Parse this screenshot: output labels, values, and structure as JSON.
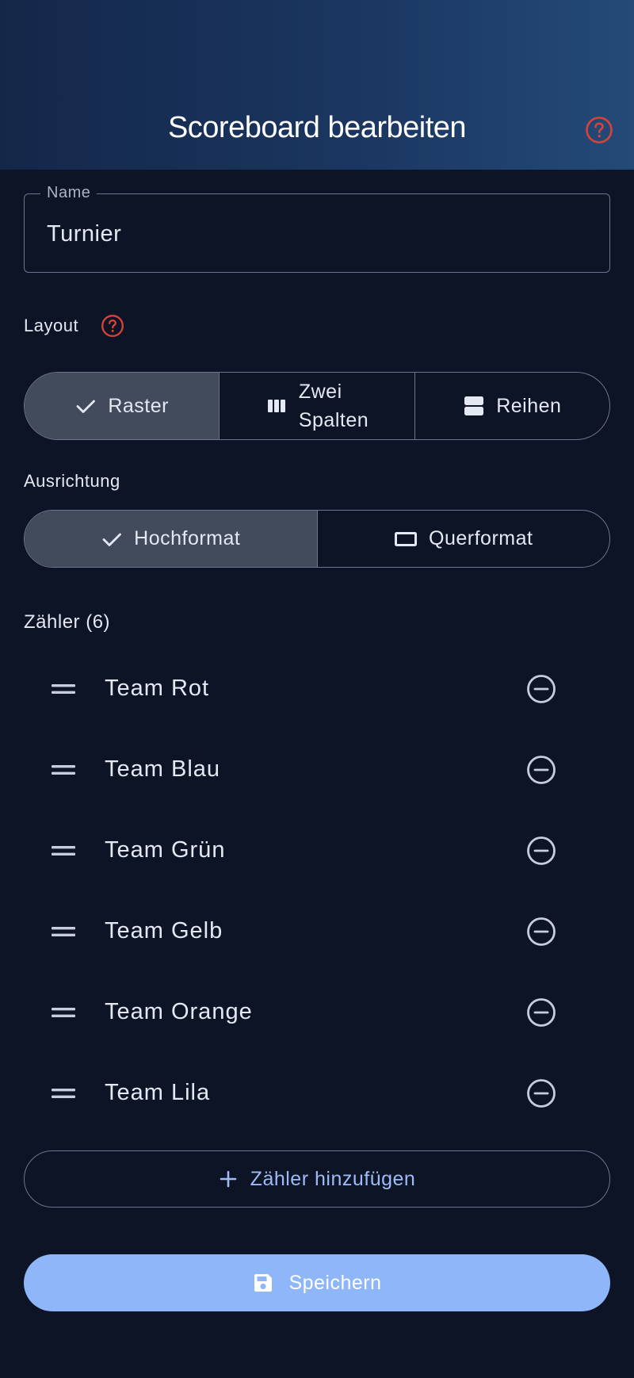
{
  "header": {
    "title": "Scoreboard bearbeiten",
    "help_icon": "help-circle-icon"
  },
  "name_field": {
    "label": "Name",
    "value": "Turnier"
  },
  "layout": {
    "label": "Layout",
    "options": [
      {
        "label": "Raster",
        "icon": "check-icon",
        "selected": true
      },
      {
        "label_line1": "Zwei",
        "label_line2": "Spalten",
        "icon": "columns-icon",
        "selected": false
      },
      {
        "label": "Reihen",
        "icon": "rows-icon",
        "selected": false
      }
    ]
  },
  "orientation": {
    "label": "Ausrichtung",
    "options": [
      {
        "label": "Hochformat",
        "icon": "check-icon",
        "selected": true
      },
      {
        "label": "Querformat",
        "icon": "landscape-icon",
        "selected": false
      }
    ]
  },
  "counters": {
    "title": "Zähler (6)",
    "items": [
      {
        "label": "Team Rot"
      },
      {
        "label": "Team Blau"
      },
      {
        "label": "Team Grün"
      },
      {
        "label": "Team Gelb"
      },
      {
        "label": "Team Orange"
      },
      {
        "label": "Team Lila"
      }
    ]
  },
  "actions": {
    "add_label": "Zähler hinzufügen",
    "save_label": "Speichern"
  },
  "colors": {
    "background": "#0d1426",
    "accent": "#8fb6f8",
    "help_icon": "#d9423a",
    "selected_segment": "#424b5c"
  }
}
